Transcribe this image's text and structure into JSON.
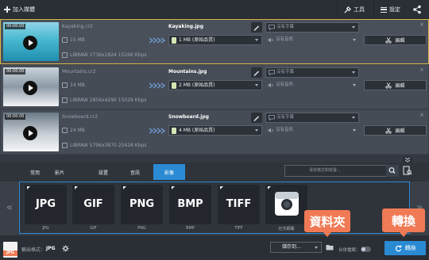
{
  "toolbar": {
    "add_media": "加入媒體",
    "tools": "工具",
    "settings": "設定"
  },
  "files": [
    {
      "timestamp": "00:00:00",
      "name": "Kayaking.cr2",
      "size": "15 MB",
      "info": "LIBRAW 2736x1824 15266 Kbps",
      "output_name": "Kayaking.jpg",
      "output_size": "1 MB (原始品質)",
      "subtitle": "沒有字幕",
      "audio": "沒有音訊",
      "edit": "編輯"
    },
    {
      "timestamp": "00:00:00",
      "name": "Mountains.cr2",
      "size": "14 MB",
      "info": "LIBRAW 2856x4290 15029 Kbps",
      "output_name": "Mountains.jpg",
      "output_size": "2 MB (原始品質)",
      "subtitle": "沒有字幕",
      "audio": "沒有音訊",
      "edit": "編輯"
    },
    {
      "timestamp": "00:00:00",
      "name": "Snowboard.cr2",
      "size": "24 MB",
      "info": "LIBRAW 5796x3870 25428 Kbps",
      "output_name": "Snowboard.jpg",
      "output_size": "4 MB (原始品質)",
      "subtitle": "沒有字幕",
      "audio": "沒有音訊",
      "edit": "編輯"
    }
  ],
  "tabs": [
    "常用",
    "影片",
    "設置",
    "音訊",
    "影像"
  ],
  "active_tab": "影像",
  "search": {
    "placeholder": "尋找格式和裝置..."
  },
  "formats": [
    {
      "big": "JPG",
      "label": "JPG"
    },
    {
      "big": "GIF",
      "label": "GIF"
    },
    {
      "big": "PNG",
      "label": "PNG"
    },
    {
      "big": "BMP",
      "label": "BMP"
    },
    {
      "big": "TIFF",
      "label": "TIFF"
    },
    {
      "big": "",
      "label": "社交網路"
    }
  ],
  "bottom": {
    "output_format_label": "輸出格式：",
    "output_format_value": "JPG",
    "save_to": "儲存到...",
    "merge": "合併檔案：",
    "convert": "轉換"
  },
  "callouts": {
    "folder": "資料夾",
    "convert": "轉換"
  },
  "colors": {
    "accent": "#2a8ad4",
    "callout": "#ef7a55",
    "selected_border": "#d9b94a"
  }
}
